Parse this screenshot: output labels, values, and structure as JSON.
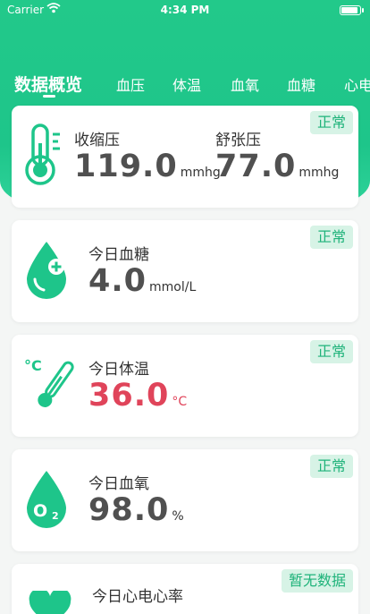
{
  "status_bar": {
    "carrier": "Carrier",
    "time": "4:34 PM"
  },
  "tabs": [
    "数据概览",
    "血压",
    "体温",
    "血氧",
    "血糖",
    "心电"
  ],
  "colors": {
    "brand": "#1ec58a",
    "badge_bg": "#d7f3e6",
    "badge_text": "#1fb37a",
    "alert": "#e0445a"
  },
  "cards": {
    "blood_pressure": {
      "icon": "thermometer-icon",
      "badge": "正常",
      "systolic_label": "收缩压",
      "systolic_value": "119.0",
      "systolic_unit": "mmhg",
      "diastolic_label": "舒张压",
      "diastolic_value": "77.0",
      "diastolic_unit": "mmhg"
    },
    "blood_sugar": {
      "icon": "blood-drop-icon",
      "badge": "正常",
      "label": "今日血糖",
      "value": "4.0",
      "unit": "mmol/L"
    },
    "temperature": {
      "icon": "thermometer-celsius-icon",
      "badge": "正常",
      "label": "今日体温",
      "value": "36.0",
      "unit": "°C"
    },
    "oxygen": {
      "icon": "oxygen-drop-icon",
      "badge": "正常",
      "label": "今日血氧",
      "value": "98.0",
      "unit": "%"
    },
    "ecg": {
      "icon": "heart-icon",
      "badge": "暂无数据",
      "label": "今日心电心率"
    }
  }
}
